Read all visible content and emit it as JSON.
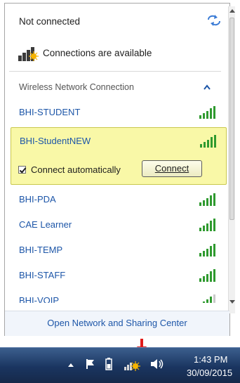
{
  "header": {
    "status": "Not connected",
    "connections_label": "Connections are available"
  },
  "section": {
    "title": "Wireless Network Connection"
  },
  "networks": [
    {
      "name": "BHI-STUDENT",
      "signal": 5
    },
    {
      "name": "BHI-StudentNEW",
      "signal": 5,
      "selected": true
    },
    {
      "name": "BHI-PDA",
      "signal": 5
    },
    {
      "name": "CAE Learner",
      "signal": 5
    },
    {
      "name": "BHI-TEMP",
      "signal": 5
    },
    {
      "name": "BHI-STAFF",
      "signal": 5
    },
    {
      "name": "BHI-VOIP",
      "signal": 4
    }
  ],
  "selected_network": {
    "auto_label": "Connect automatically",
    "auto_checked": true,
    "connect_label": "Connect"
  },
  "footer": {
    "link": "Open Network and Sharing Center"
  },
  "taskbar": {
    "time": "1:43 PM",
    "date": "30/09/2015"
  },
  "icons": {
    "refresh": "refresh-icon",
    "signal": "signal-bars-icon",
    "network_available": "network-available-icon",
    "collapse": "chevron-up-icon"
  },
  "colors": {
    "link": "#1d56a8",
    "selected_bg": "#f9f8a7",
    "signal_green": "#2f9a2f",
    "arrow_red": "#e01b1b"
  }
}
